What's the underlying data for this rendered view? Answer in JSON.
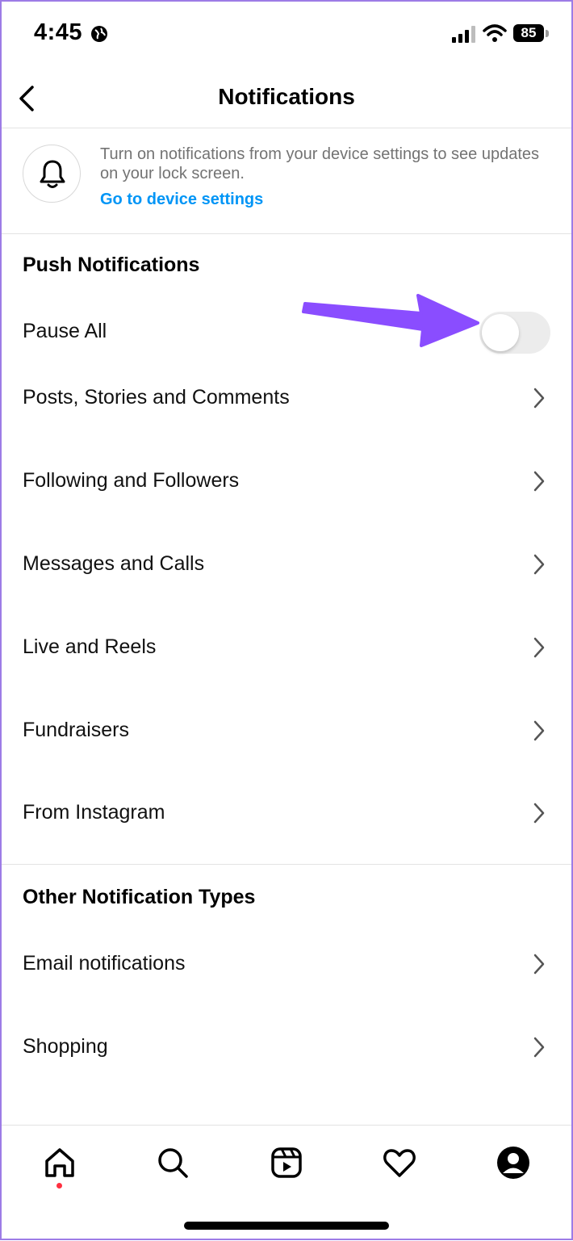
{
  "status_bar": {
    "time": "4:45",
    "battery": "85"
  },
  "header": {
    "title": "Notifications"
  },
  "device_banner": {
    "message": "Turn on notifications from your device settings to see updates on your lock screen.",
    "link": "Go to device settings"
  },
  "push": {
    "title": "Push Notifications",
    "pause_all": {
      "label": "Pause All",
      "on": false
    },
    "items": [
      {
        "label": "Posts, Stories and Comments"
      },
      {
        "label": "Following and Followers"
      },
      {
        "label": "Messages and Calls"
      },
      {
        "label": "Live and Reels"
      },
      {
        "label": "Fundraisers"
      },
      {
        "label": "From Instagram"
      }
    ]
  },
  "other": {
    "title": "Other Notification Types",
    "items": [
      {
        "label": "Email notifications"
      },
      {
        "label": "Shopping"
      }
    ]
  },
  "tab_bar": {
    "icons": [
      "home-icon",
      "search-icon",
      "reels-icon",
      "heart-icon",
      "profile-icon"
    ],
    "active": "home-icon"
  },
  "colors": {
    "link": "#0095f6",
    "annotation_arrow": "#8a4dff",
    "unread_dot": "#ff3040"
  }
}
